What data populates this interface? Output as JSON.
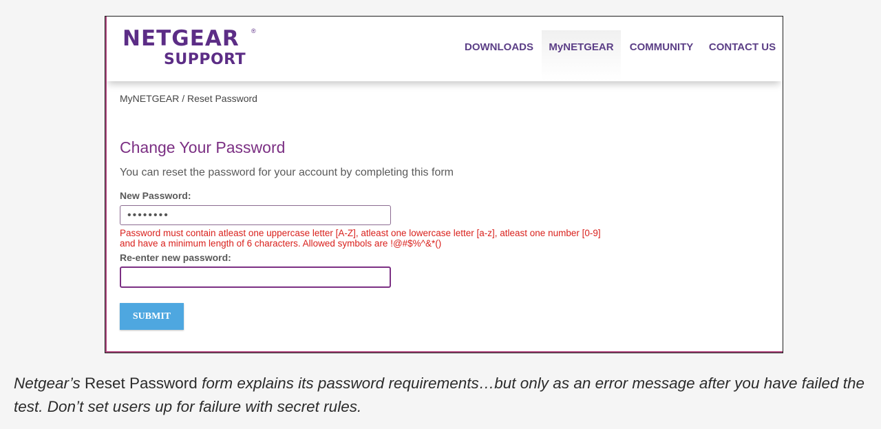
{
  "brand": {
    "name": "NETGEAR",
    "registered_mark": "®",
    "subtitle": "SUPPORT",
    "color": "#5c2d86"
  },
  "nav": {
    "items": [
      {
        "label": "DOWNLOADS"
      },
      {
        "label": "MyNETGEAR",
        "active": true
      },
      {
        "label": "COMMUNITY"
      },
      {
        "label": "CONTACT US"
      }
    ]
  },
  "breadcrumb": "MyNETGEAR / Reset Password",
  "form": {
    "title": "Change Your Password",
    "intro": "You can reset the password for your account by completing this form",
    "new_password": {
      "label": "New Password:",
      "value": "••••••••"
    },
    "error": {
      "line1": "Password must contain atleast one uppercase letter [A-Z], atleast one lowercase letter [a-z], atleast one number [0-9]",
      "line2": "and have a minimum length of 6 characters. Allowed symbols are !@#$%^&*()",
      "color": "#d9201c"
    },
    "reenter_password": {
      "label": "Re-enter new password:",
      "value": ""
    },
    "submit_label": "SUBMIT",
    "accent_color": "#4ea7e0",
    "title_color": "#7b2f83"
  },
  "caption": {
    "part1": "Netgear’s",
    "part2": "Reset Password",
    "part3": "form explains its password requirements…but only as an error message after you have failed the test. Don’t set users up for failure with secret rules."
  }
}
